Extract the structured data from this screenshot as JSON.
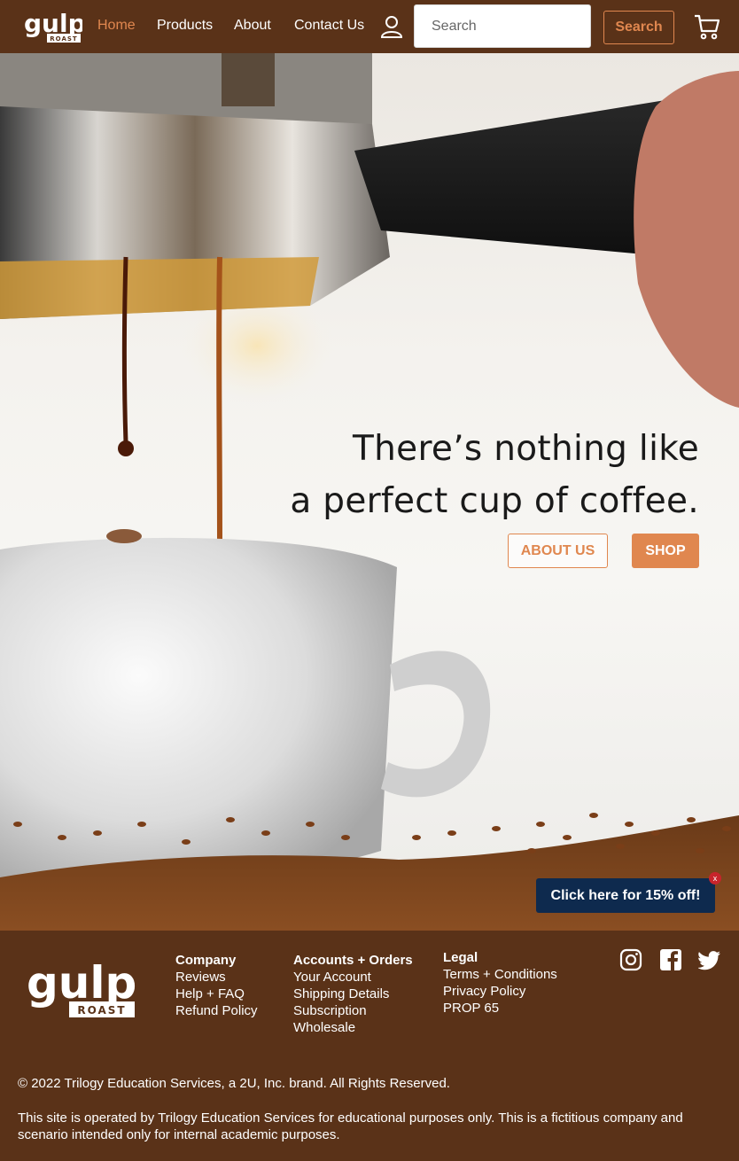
{
  "nav": {
    "logo_text": "gulp",
    "logo_sub": "ROAST",
    "links": [
      {
        "label": "Home",
        "active": true
      },
      {
        "label": "Products",
        "active": false
      },
      {
        "label": "About",
        "active": false
      },
      {
        "label": "Contact Us",
        "active": false
      }
    ],
    "search_placeholder": "Search",
    "search_button": "Search",
    "icons": [
      "user-icon",
      "cart-icon"
    ]
  },
  "hero": {
    "headline_line1": "There’s nothing like",
    "headline_line2": "a perfect cup of coffee.",
    "about_button": "ABOUT US",
    "shop_button": "SHOP"
  },
  "promo": {
    "label": "Click here for 15% off!",
    "close": "x"
  },
  "footer": {
    "logo_text": "gulp",
    "logo_sub": "ROAST",
    "company": {
      "heading": "Company",
      "links": [
        "Reviews",
        "Help + FAQ",
        "Refund Policy"
      ]
    },
    "accounts": {
      "heading": "Accounts + Orders",
      "links": [
        "Your Account",
        "Shipping Details",
        "Subscription",
        "Wholesale"
      ]
    },
    "legal": {
      "heading": "Legal",
      "links": [
        "Terms + Conditions",
        "Privacy Policy",
        "PROP 65"
      ]
    },
    "social_icons": [
      "instagram-icon",
      "facebook-icon",
      "twitter-icon"
    ],
    "copyright": "© 2022 Trilogy Education Services, a 2U, Inc. brand. All Rights Reserved.",
    "disclaimer": "This site is operated by Trilogy Education Services for educational purposes only. This is a fictitious company and scenario intended only for internal academic purposes."
  },
  "colors": {
    "brand_brown": "#5a3218",
    "accent_orange": "#e0874f",
    "promo_navy": "#0e2a4e"
  }
}
